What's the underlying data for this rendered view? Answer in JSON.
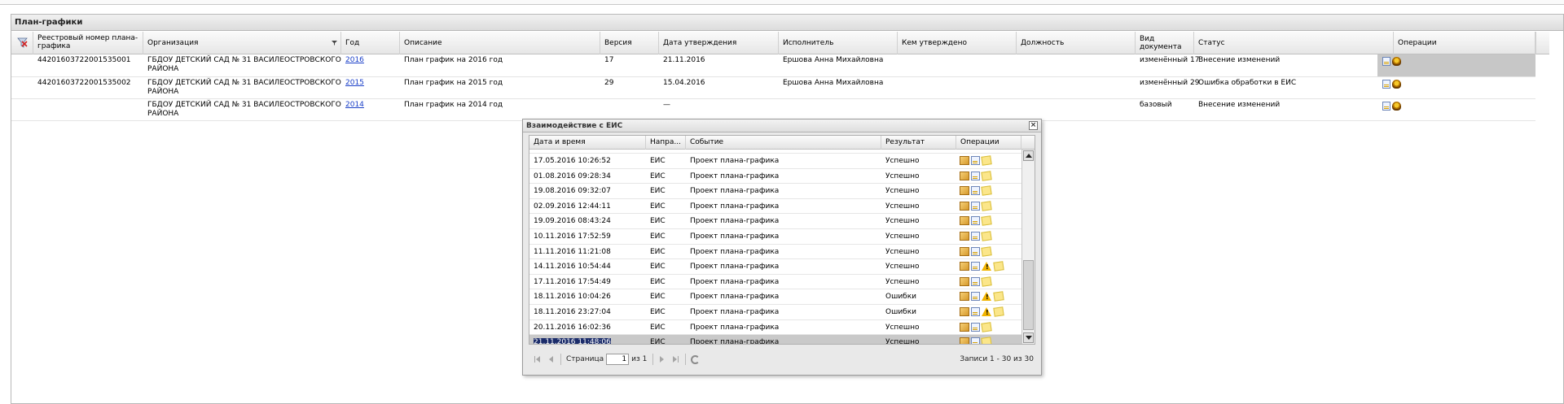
{
  "panel": {
    "title": "План-графики"
  },
  "grid": {
    "columns": {
      "reg_number": "Реестровый номер плана-графика",
      "org": "Организация",
      "year": "Год",
      "description": "Описание",
      "version": "Версия",
      "approve_date": "Дата утверждения",
      "executor": "Исполнитель",
      "approved_by": "Кем утверждено",
      "position": "Должность",
      "doc_type": "Вид документа",
      "status": "Статус",
      "operations": "Операции"
    },
    "rows": [
      {
        "reg_number": "4420160372200153500​1",
        "org": "ГБДОУ ДЕТСКИЙ САД № 31 ВАСИЛЕОСТРОВСКОГО РАЙОНА",
        "year": "2016",
        "description": "План график на 2016 год",
        "version": "17",
        "approve_date": "21.11.2016",
        "executor": "Ершова Анна Михайловна",
        "approved_by": "",
        "position": "",
        "doc_type": "изменённый 17",
        "status": "Внесение изменений"
      },
      {
        "reg_number": "44201603722001535002",
        "org": "ГБДОУ ДЕТСКИЙ САД № 31 ВАСИЛЕОСТРОВСКОГО РАЙОНА",
        "year": "2015",
        "description": "План график на 2015 год",
        "version": "29",
        "approve_date": "15.04.2016",
        "executor": "Ершова Анна Михайловна",
        "approved_by": "",
        "position": "",
        "doc_type": "изменённый 29",
        "status": "Ошибка обработки в ЕИС"
      },
      {
        "reg_number": "",
        "org": "ГБДОУ ДЕТСКИЙ САД № 31 ВАСИЛЕОСТРОВСКОГО РАЙОНА",
        "year": "2014",
        "description": "План график на 2014 год",
        "version": "",
        "approve_date": "—",
        "executor": "",
        "approved_by": "",
        "position": "",
        "doc_type": "базовый",
        "status": "Внесение изменений"
      }
    ]
  },
  "dialog": {
    "title": "Взаимодействие с ЕИС",
    "close": "×",
    "columns": {
      "datetime": "Дата и время",
      "direction": "Напра...",
      "event": "Событие",
      "result": "Результат",
      "operations": "Операции"
    },
    "rows": [
      {
        "datetime": "17.05.2016 10:26:52",
        "direction": "ЕИС",
        "event": "Проект плана-графика",
        "result": "Успешно",
        "warn": false
      },
      {
        "datetime": "01.08.2016 09:28:34",
        "direction": "ЕИС",
        "event": "Проект плана-графика",
        "result": "Успешно",
        "warn": false
      },
      {
        "datetime": "19.08.2016 09:32:07",
        "direction": "ЕИС",
        "event": "Проект плана-графика",
        "result": "Успешно",
        "warn": false
      },
      {
        "datetime": "02.09.2016 12:44:11",
        "direction": "ЕИС",
        "event": "Проект плана-графика",
        "result": "Успешно",
        "warn": false
      },
      {
        "datetime": "19.09.2016 08:43:24",
        "direction": "ЕИС",
        "event": "Проект плана-графика",
        "result": "Успешно",
        "warn": false
      },
      {
        "datetime": "10.11.2016 17:52:59",
        "direction": "ЕИС",
        "event": "Проект плана-графика",
        "result": "Успешно",
        "warn": false
      },
      {
        "datetime": "11.11.2016 11:21:08",
        "direction": "ЕИС",
        "event": "Проект плана-графика",
        "result": "Успешно",
        "warn": false
      },
      {
        "datetime": "14.11.2016 10:54:44",
        "direction": "ЕИС",
        "event": "Проект плана-графика",
        "result": "Успешно",
        "warn": true
      },
      {
        "datetime": "17.11.2016 17:54:49",
        "direction": "ЕИС",
        "event": "Проект плана-графика",
        "result": "Успешно",
        "warn": false
      },
      {
        "datetime": "18.11.2016 10:04:26",
        "direction": "ЕИС",
        "event": "Проект плана-графика",
        "result": "Ошибки",
        "warn": true
      },
      {
        "datetime": "18.11.2016 23:27:04",
        "direction": "ЕИС",
        "event": "Проект плана-графика",
        "result": "Ошибки",
        "warn": true
      },
      {
        "datetime": "20.11.2016 16:02:36",
        "direction": "ЕИС",
        "event": "Проект плана-графика",
        "result": "Успешно",
        "warn": false
      },
      {
        "datetime": "21.11.2016 11:48:06",
        "direction": "ЕИС",
        "event": "Проект плана-графика",
        "result": "Успешно",
        "warn": false
      }
    ],
    "pager": {
      "page_label": "Страница",
      "page_value": "1",
      "of_label": "из 1",
      "records": "Записи 1 - 30 из 30"
    }
  }
}
